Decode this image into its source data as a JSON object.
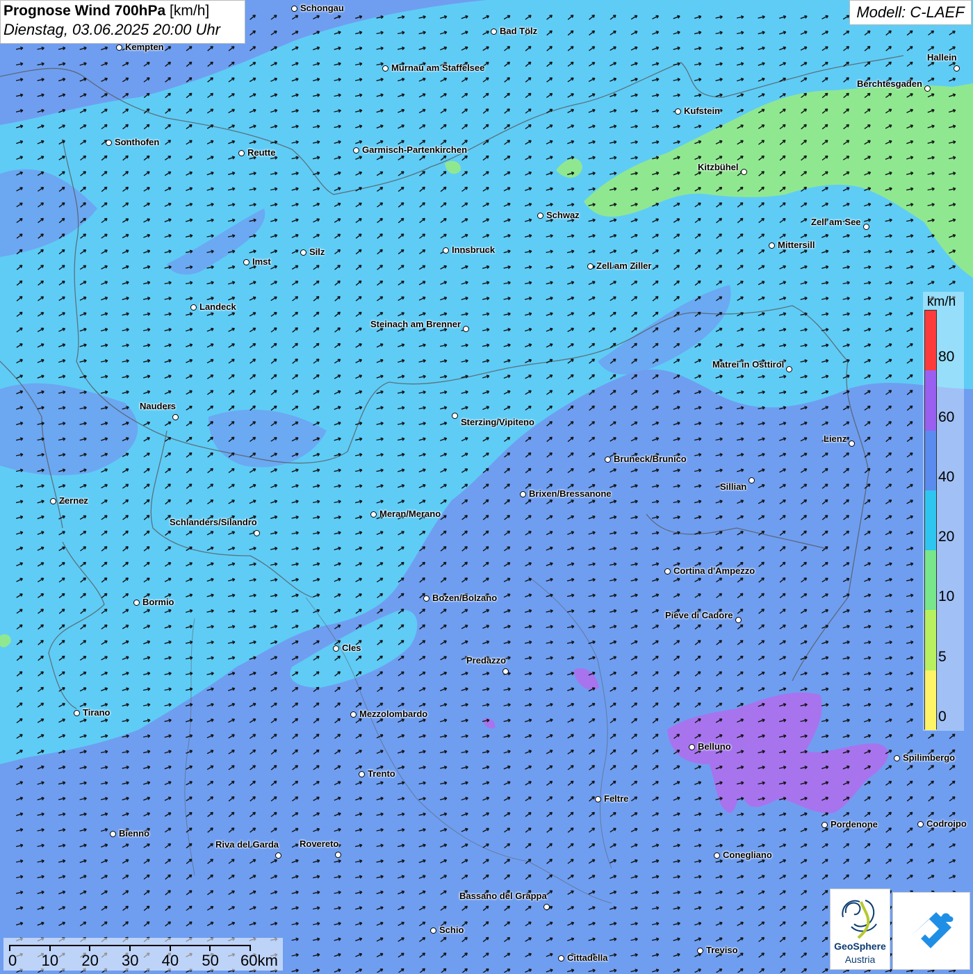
{
  "header": {
    "title_bold": "Prognose Wind 700hPa",
    "title_unit": "[km/h]",
    "datetime": "Dienstag, 03.06.2025 20:00 Uhr",
    "model": "Modell: C-LAEF"
  },
  "legend": {
    "unit": "km/h",
    "ticks": [
      "80",
      "60",
      "40",
      "20",
      "10",
      "5",
      "0"
    ],
    "colors": [
      "#ff3a3a",
      "#9a5ff0",
      "#5a8cf0",
      "#2ec6f0",
      "#78e68a",
      "#b8f060",
      "#fff466"
    ]
  },
  "scale_bar": {
    "labels": [
      "0",
      "10",
      "20",
      "30",
      "40",
      "50",
      "60km"
    ]
  },
  "logos": {
    "geosphere_name": "GeoSphere",
    "geosphere_sub": "Austria"
  },
  "cities": [
    {
      "name": "Schongau"
    },
    {
      "name": "Bad Tölz"
    },
    {
      "name": "Kempten"
    },
    {
      "name": "Murnau am Staffelsee"
    },
    {
      "name": "Hallein"
    },
    {
      "name": "Berchtesgaden"
    },
    {
      "name": "Kufstein"
    },
    {
      "name": "Sonthofen"
    },
    {
      "name": "Reutte"
    },
    {
      "name": "Garmisch-Partenkirchen"
    },
    {
      "name": "Kitzbühel"
    },
    {
      "name": "Schwaz"
    },
    {
      "name": "Zell am See"
    },
    {
      "name": "Mittersill"
    },
    {
      "name": "Imst"
    },
    {
      "name": "Silz"
    },
    {
      "name": "Innsbruck"
    },
    {
      "name": "Zell am Ziller"
    },
    {
      "name": "Landeck"
    },
    {
      "name": "Steinach am Brenner"
    },
    {
      "name": "Matrei in Osttirol"
    },
    {
      "name": "Nauders"
    },
    {
      "name": "Sterzing/Vipiteno"
    },
    {
      "name": "Lienz"
    },
    {
      "name": "Bruneck/Brunico"
    },
    {
      "name": "Sillian"
    },
    {
      "name": "Zernez"
    },
    {
      "name": "Brixen/Bressanone"
    },
    {
      "name": "Meran/Merano"
    },
    {
      "name": "Schlanders/Silandro"
    },
    {
      "name": "Cortina d'Ampezzo"
    },
    {
      "name": "Bozen/Bolzano"
    },
    {
      "name": "Bormio"
    },
    {
      "name": "Pieve di Cadore"
    },
    {
      "name": "Cles"
    },
    {
      "name": "Predazzo"
    },
    {
      "name": "Tirano"
    },
    {
      "name": "Mezzolombardo"
    },
    {
      "name": "Belluno"
    },
    {
      "name": "Spilimbergo"
    },
    {
      "name": "Trento"
    },
    {
      "name": "Feltre"
    },
    {
      "name": "Pordenone"
    },
    {
      "name": "Codroipo"
    },
    {
      "name": "Bienno"
    },
    {
      "name": "Riva del Garda"
    },
    {
      "name": "Rovereto"
    },
    {
      "name": "Conegliano"
    },
    {
      "name": "Bassano del Grappa"
    },
    {
      "name": "Schio"
    },
    {
      "name": "Treviso"
    },
    {
      "name": "Cittadella"
    }
  ]
}
